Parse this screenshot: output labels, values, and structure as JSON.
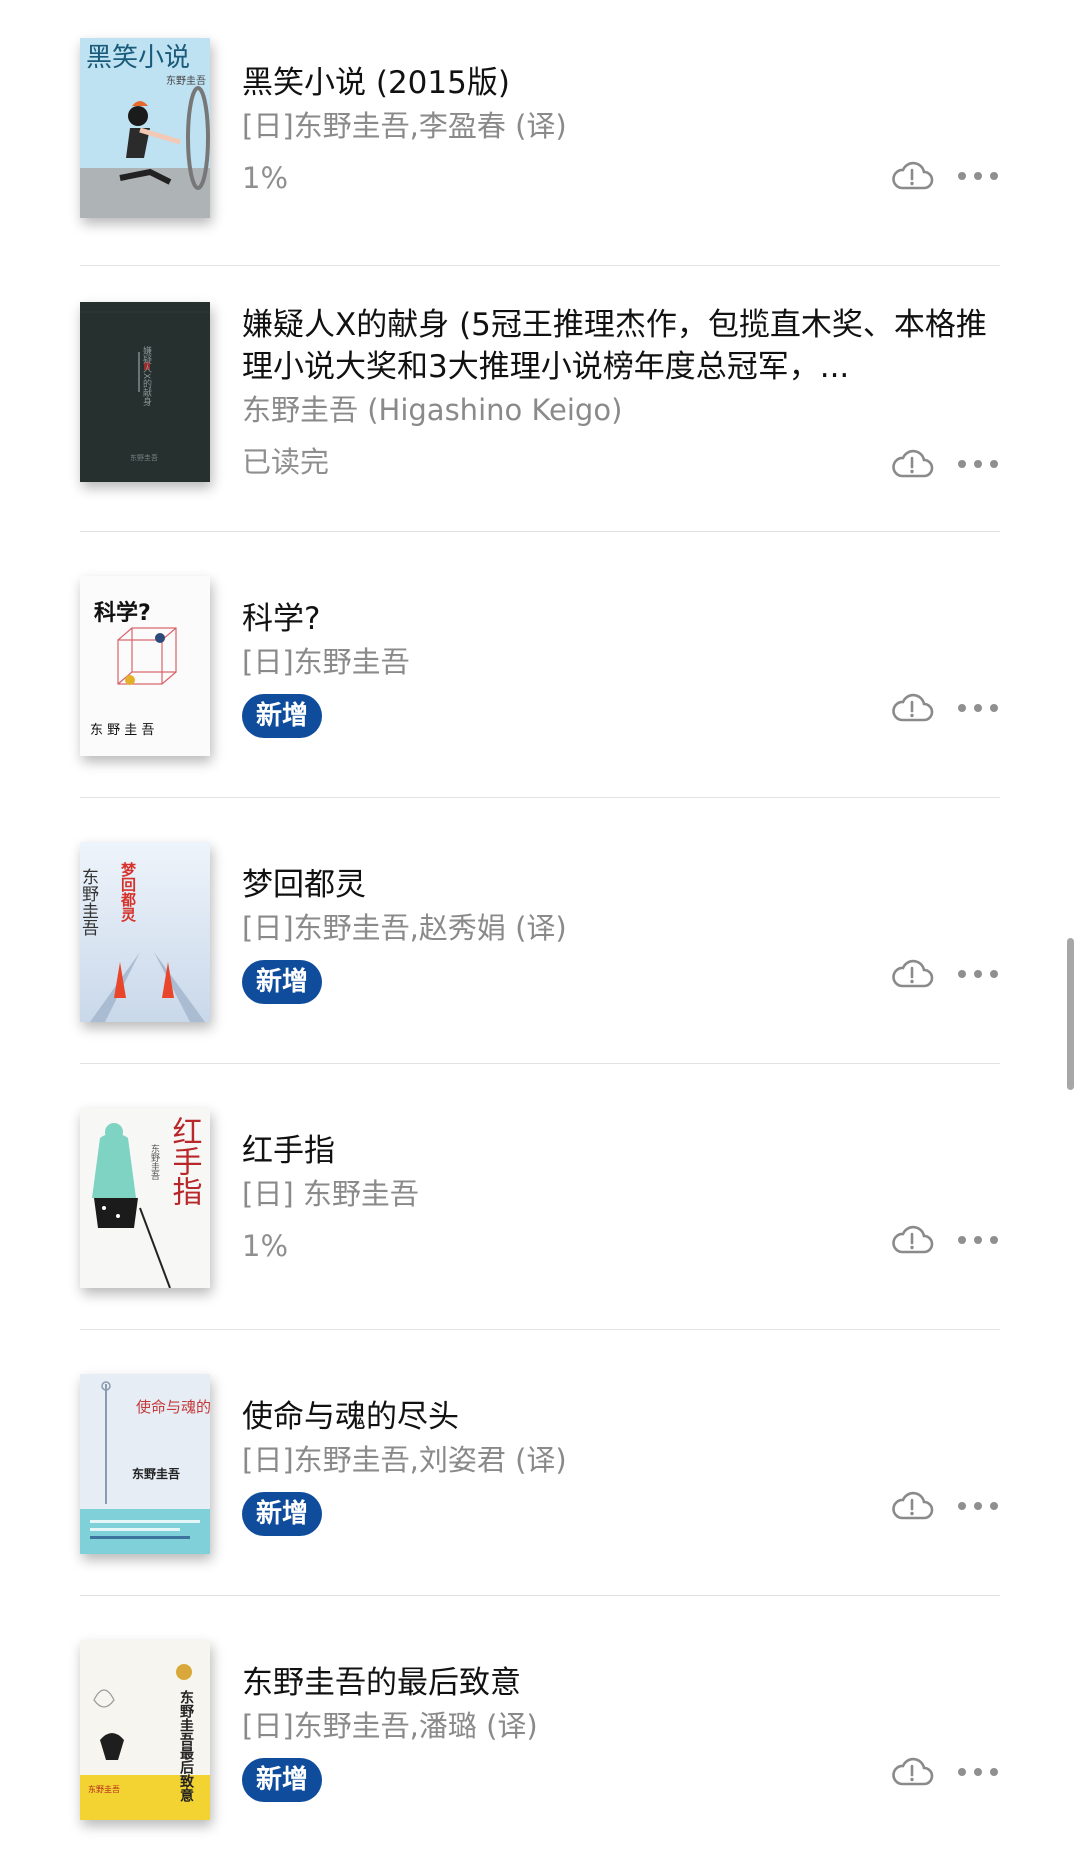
{
  "books": [
    {
      "title": "黑笑小说 (2015版)",
      "author": "[日]东野圭吾,李盈春 (译)",
      "status": "1%",
      "badge": "",
      "cover_text": "黑笑小说",
      "cover_subtext": "东野圭吾"
    },
    {
      "title": "嫌疑人X的献身 (5冠王推理杰作，包揽直木奖、本格推理小说大奖和3大推理小说榜年度总冠军，...",
      "author": "东野圭吾 (Higashino Keigo)",
      "status": "已读完",
      "badge": "",
      "cover_text": "嫌疑人X的献身",
      "cover_subtext": "东野圭吾"
    },
    {
      "title": "科学?",
      "author": "[日]东野圭吾",
      "status": "",
      "badge": "新增",
      "cover_text": "科学?",
      "cover_subtext": "东 野 圭 吾"
    },
    {
      "title": "梦回都灵",
      "author": "[日]东野圭吾,赵秀娟 (译)",
      "status": "",
      "badge": "新增",
      "cover_text": "梦回都灵",
      "cover_subtext": "东野圭吾"
    },
    {
      "title": "红手指",
      "author": "[日] 东野圭吾",
      "status": "1%",
      "badge": "",
      "cover_text": "红手指",
      "cover_subtext": "东野圭吾"
    },
    {
      "title": "使命与魂的尽头",
      "author": "[日]东野圭吾,刘姿君 (译)",
      "status": "",
      "badge": "新增",
      "cover_text": "使命与魂的尽头",
      "cover_subtext": "东野圭吾"
    },
    {
      "title": "东野圭吾的最后致意",
      "author": "[日]东野圭吾,潘璐 (译)",
      "status": "",
      "badge": "新增",
      "cover_text": "东野圭吾最后致意",
      "cover_subtext": "东野圭吾"
    }
  ],
  "icons": {
    "cloud": "cloud-download-icon",
    "more": "more-options-icon"
  },
  "colors": {
    "badge_bg": "#0f4c9c",
    "divider": "#e2e2e2",
    "secondary_text": "#8a8a8a"
  }
}
